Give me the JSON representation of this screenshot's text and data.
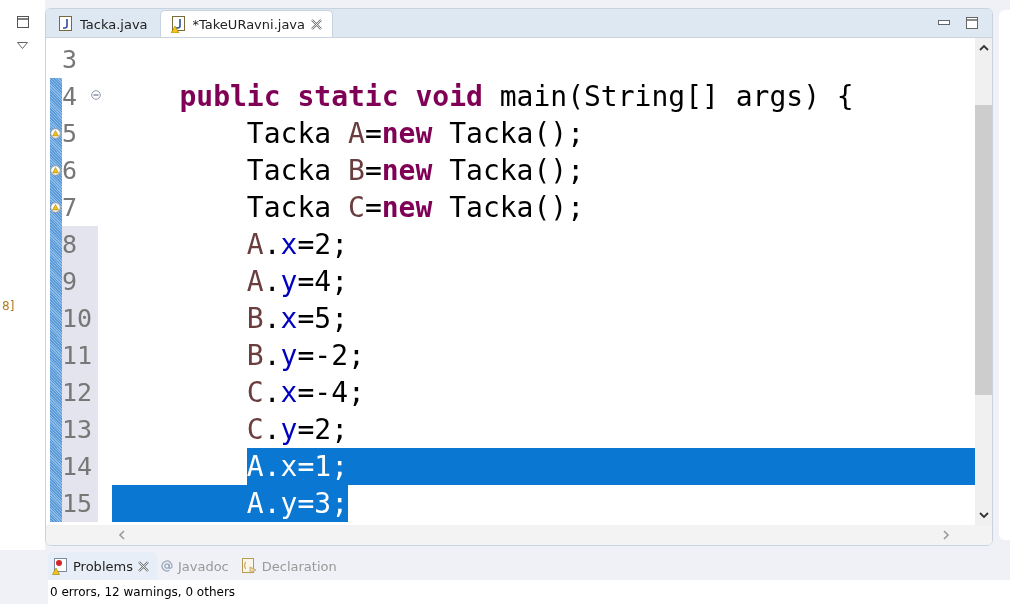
{
  "left_panel": {
    "fragment": "8]"
  },
  "editor_tabs": [
    {
      "label": "Tacka.java",
      "selected": false,
      "warning": false,
      "closable": false
    },
    {
      "label": "*TakeURavni.java",
      "selected": true,
      "warning": true,
      "closable": true
    }
  ],
  "code_lines": [
    {
      "number": "3",
      "kind": "blank",
      "marked": false,
      "highlighted": false,
      "warning": false,
      "foldable": false,
      "line_end_selected": false
    },
    {
      "number": "4",
      "kind": "method",
      "marked": true,
      "highlighted": false,
      "warning": false,
      "foldable": true,
      "text_selected": false,
      "indent_selected": false,
      "line_end_selected": false,
      "tokens": [
        {
          "text": "public static void",
          "kind": "keyword"
        },
        {
          "text": " main(String[] args) {",
          "kind": "plain"
        }
      ]
    },
    {
      "number": "5",
      "kind": "statement",
      "marked": true,
      "highlighted": false,
      "warning": true,
      "foldable": false,
      "text_selected": false,
      "indent_selected": false,
      "line_end_selected": false,
      "tokens": [
        {
          "text": "Tacka ",
          "kind": "plain"
        },
        {
          "text": "A",
          "kind": "local"
        },
        {
          "text": "=",
          "kind": "plain"
        },
        {
          "text": "new",
          "kind": "keyword"
        },
        {
          "text": " Tacka();",
          "kind": "plain"
        }
      ]
    },
    {
      "number": "6",
      "kind": "statement",
      "marked": true,
      "highlighted": false,
      "warning": true,
      "foldable": false,
      "text_selected": false,
      "indent_selected": false,
      "line_end_selected": false,
      "tokens": [
        {
          "text": "Tacka ",
          "kind": "plain"
        },
        {
          "text": "B",
          "kind": "local"
        },
        {
          "text": "=",
          "kind": "plain"
        },
        {
          "text": "new",
          "kind": "keyword"
        },
        {
          "text": " Tacka();",
          "kind": "plain"
        }
      ]
    },
    {
      "number": "7",
      "kind": "statement",
      "marked": true,
      "highlighted": false,
      "warning": true,
      "foldable": false,
      "text_selected": false,
      "indent_selected": false,
      "line_end_selected": false,
      "tokens": [
        {
          "text": "Tacka ",
          "kind": "plain"
        },
        {
          "text": "C",
          "kind": "local"
        },
        {
          "text": "=",
          "kind": "plain"
        },
        {
          "text": "new",
          "kind": "keyword"
        },
        {
          "text": " Tacka();",
          "kind": "plain"
        }
      ]
    },
    {
      "number": "8",
      "kind": "statement",
      "marked": true,
      "highlighted": true,
      "warning": false,
      "foldable": false,
      "text_selected": false,
      "indent_selected": false,
      "line_end_selected": false,
      "tokens": [
        {
          "text": "A",
          "kind": "local"
        },
        {
          "text": ".",
          "kind": "plain"
        },
        {
          "text": "x",
          "kind": "field"
        },
        {
          "text": "=2;",
          "kind": "plain"
        }
      ]
    },
    {
      "number": "9",
      "kind": "statement",
      "marked": true,
      "highlighted": true,
      "warning": false,
      "foldable": false,
      "text_selected": false,
      "indent_selected": false,
      "line_end_selected": false,
      "tokens": [
        {
          "text": "A",
          "kind": "local"
        },
        {
          "text": ".",
          "kind": "plain"
        },
        {
          "text": "y",
          "kind": "field"
        },
        {
          "text": "=4;",
          "kind": "plain"
        }
      ]
    },
    {
      "number": "10",
      "kind": "statement",
      "marked": true,
      "highlighted": true,
      "warning": false,
      "foldable": false,
      "text_selected": false,
      "indent_selected": false,
      "line_end_selected": false,
      "tokens": [
        {
          "text": "B",
          "kind": "local"
        },
        {
          "text": ".",
          "kind": "plain"
        },
        {
          "text": "x",
          "kind": "field"
        },
        {
          "text": "=5;",
          "kind": "plain"
        }
      ]
    },
    {
      "number": "11",
      "kind": "statement",
      "marked": true,
      "highlighted": true,
      "warning": false,
      "foldable": false,
      "text_selected": false,
      "indent_selected": false,
      "line_end_selected": false,
      "tokens": [
        {
          "text": "B",
          "kind": "local"
        },
        {
          "text": ".",
          "kind": "plain"
        },
        {
          "text": "y",
          "kind": "field"
        },
        {
          "text": "=-2;",
          "kind": "plain"
        }
      ]
    },
    {
      "number": "12",
      "kind": "statement",
      "marked": true,
      "highlighted": true,
      "warning": false,
      "foldable": false,
      "text_selected": false,
      "indent_selected": false,
      "line_end_selected": false,
      "tokens": [
        {
          "text": "C",
          "kind": "local"
        },
        {
          "text": ".",
          "kind": "plain"
        },
        {
          "text": "x",
          "kind": "field"
        },
        {
          "text": "=-4;",
          "kind": "plain"
        }
      ]
    },
    {
      "number": "13",
      "kind": "statement",
      "marked": true,
      "highlighted": true,
      "warning": false,
      "foldable": false,
      "text_selected": false,
      "indent_selected": false,
      "line_end_selected": false,
      "tokens": [
        {
          "text": "C",
          "kind": "local"
        },
        {
          "text": ".",
          "kind": "plain"
        },
        {
          "text": "y",
          "kind": "field"
        },
        {
          "text": "=2;",
          "kind": "plain"
        }
      ]
    },
    {
      "number": "14",
      "kind": "statement",
      "marked": true,
      "highlighted": true,
      "warning": false,
      "foldable": false,
      "text_selected": true,
      "indent_selected": false,
      "line_end_selected": true,
      "tokens": [
        {
          "text": "A",
          "kind": "local"
        },
        {
          "text": ".",
          "kind": "plain"
        },
        {
          "text": "x",
          "kind": "field"
        },
        {
          "text": "=1;",
          "kind": "plain"
        }
      ]
    },
    {
      "number": "15",
      "kind": "statement",
      "marked": true,
      "highlighted": true,
      "warning": false,
      "foldable": false,
      "text_selected": true,
      "indent_selected": true,
      "line_end_selected": false,
      "tokens": [
        {
          "text": "A",
          "kind": "local"
        },
        {
          "text": ".",
          "kind": "plain"
        },
        {
          "text": "y",
          "kind": "field"
        },
        {
          "text": "=3;",
          "kind": "plain"
        }
      ]
    }
  ],
  "bottom_tabs": [
    {
      "label": "Problems",
      "kind": "problems",
      "selected": true,
      "closable": true
    },
    {
      "label": "Javadoc",
      "kind": "javadoc",
      "selected": false,
      "closable": false
    },
    {
      "label": "Declaration",
      "kind": "declaration",
      "selected": false,
      "closable": false
    }
  ],
  "status": "0 errors, 12 warnings, 0 others"
}
